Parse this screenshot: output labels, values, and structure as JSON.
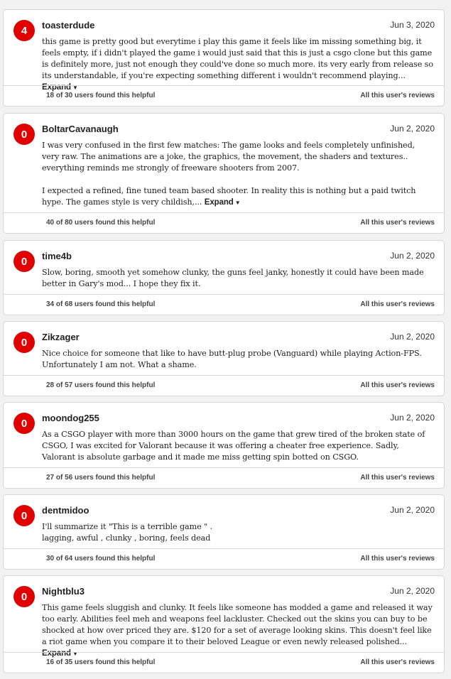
{
  "reviews": [
    {
      "score": "4",
      "user": "toasterdude",
      "date": "Jun 3, 2020",
      "paras": [
        "this game is pretty good but everytime i play this game it feels like im missing something big, it feels empty, if i didn't played the game i would just said that this is just a csgo clone but this game is definitely more, just not enough they could've done so much more. its very early from release so its understandable, if you're expecting something different i wouldn't recommend playing..."
      ],
      "expand": "Expand",
      "helpful": "18 of 30 users found this helpful",
      "all_reviews": "All this user's reviews"
    },
    {
      "score": "0",
      "user": "BoltarCavanaugh",
      "date": "Jun 2, 2020",
      "paras": [
        "I was very confused in the first few matches: The game looks and feels completely unfinished, very raw. The animations are a joke, the graphics, the movement, the shaders and textures.. everything reminds me strongly of freeware shooters from 2007.",
        "I expected a refined, fine tuned team based shooter. In reality this is nothing but a paid twitch hype. The games style is very childish,..."
      ],
      "expand": "Expand",
      "helpful": "40 of 80 users found this helpful",
      "all_reviews": "All this user's reviews"
    },
    {
      "score": "0",
      "user": "time4b",
      "date": "Jun 2, 2020",
      "paras": [
        "Slow, boring, smooth yet somehow clunky, the guns feel janky, honestly it could have been made better in Gary's mod... I hope they fix it."
      ],
      "expand": "",
      "helpful": "34 of 68 users found this helpful",
      "all_reviews": "All this user's reviews"
    },
    {
      "score": "0",
      "user": "Zikzager",
      "date": "Jun 2, 2020",
      "paras": [
        "Nice choice for someone that like to have butt-plug probe (Vanguard) while playing Action-FPS. Unfortunately I am not. What a shame."
      ],
      "expand": "",
      "helpful": "28 of 57 users found this helpful",
      "all_reviews": "All this user's reviews"
    },
    {
      "score": "0",
      "user": "moondog255",
      "date": "Jun 2, 2020",
      "paras": [
        "As a CSGO player with more than 3000 hours on the game that grew tired of the broken state of CSGO, I was excited for Valorant because it was offering a cheater free experience. Sadly, Valorant is absolute garbage and it made me miss getting spin botted on CSGO."
      ],
      "expand": "",
      "helpful": "27 of 56 users found this helpful",
      "all_reviews": "All this user's reviews"
    },
    {
      "score": "0",
      "user": "dentmidoo",
      "date": "Jun 2, 2020",
      "paras": [
        "I'll summarize it \"This is a terrible game \" .",
        "lagging, awful , clunky , boring, feels dead"
      ],
      "tight": true,
      "expand": "",
      "helpful": "30 of 64 users found this helpful",
      "all_reviews": "All this user's reviews"
    },
    {
      "score": "0",
      "user": "Nightblu3",
      "date": "Jun 2, 2020",
      "paras": [
        "This game feels sluggish and clunky. It feels like someone has modded a game and released it way too early. Abilities feel meh and weapons feel lackluster. Checked out the skins you can buy to be shocked at how over priced they are. $120 for a set of average looking skins. This doesn't feel like a riot game when you compare it to their beloved League or even newly released polished..."
      ],
      "expand": "Expand",
      "helpful": "16 of 35 users found this helpful",
      "all_reviews": "All this user's reviews"
    }
  ]
}
